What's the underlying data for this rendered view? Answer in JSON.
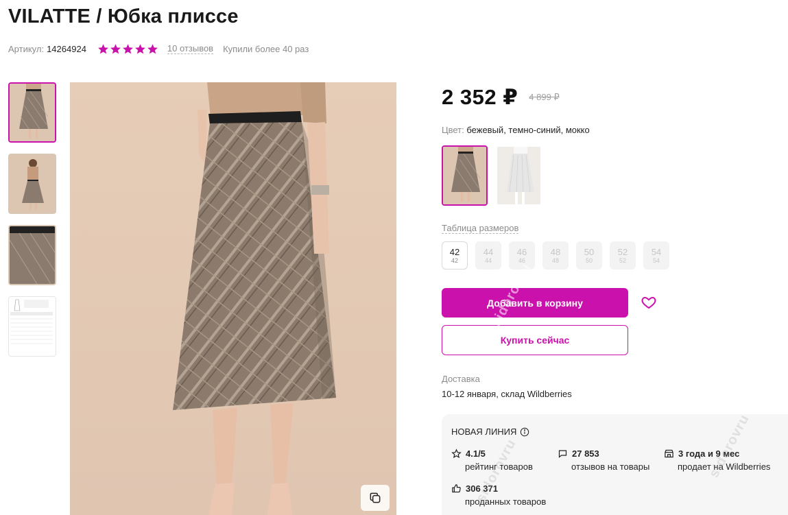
{
  "product": {
    "title": "VILATTE / Юбка плиссе",
    "article_label": "Артикул:",
    "article_value": "14264924",
    "rating_stars": 5,
    "reviews_link": "10 отзывов",
    "bought_text": "Купили более 40 раз"
  },
  "gallery": {
    "thumbnails": [
      "photo-1",
      "photo-2",
      "photo-3",
      "size-table"
    ],
    "active_index": 0,
    "size_table_thumb_title": "ТАБЛИЦА ИЗМЕРЕНИЙ в см"
  },
  "price": {
    "current": "2 352 ₽",
    "old": "4 899 ₽"
  },
  "color": {
    "label": "Цвет:",
    "value": "бежевый, темно-синий, мокко"
  },
  "sizes": {
    "table_link": "Таблица размеров",
    "items": [
      {
        "ru": "42",
        "eu": "42"
      },
      {
        "ru": "44",
        "eu": "44"
      },
      {
        "ru": "46",
        "eu": "46"
      },
      {
        "ru": "48",
        "eu": "48"
      },
      {
        "ru": "50",
        "eu": "50"
      },
      {
        "ru": "52",
        "eu": "52"
      },
      {
        "ru": "54",
        "eu": "54"
      }
    ]
  },
  "actions": {
    "add_to_cart": "Добавить в корзину",
    "buy_now": "Купить сейчас"
  },
  "delivery": {
    "label": "Доставка",
    "value": "10-12 января, склад Wildberries"
  },
  "seller": {
    "name": "НОВАЯ ЛИНИЯ",
    "rating_value": "4.1/5",
    "rating_label": "рейтинг товаров",
    "reviews_value": "27 853",
    "reviews_label": "отзывов на товары",
    "years_value": "3 года и 9 мес",
    "years_label": "продает на Wildberries",
    "sold_value": "306 371",
    "sold_label": "проданных товаров"
  },
  "watermark": "sidorovru",
  "colors": {
    "accent": "#cb11ab",
    "text": "#242424",
    "muted": "#8b8b8b"
  }
}
